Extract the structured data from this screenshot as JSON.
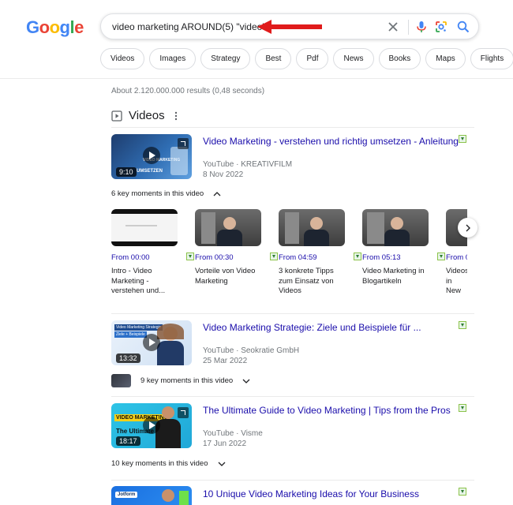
{
  "logo": {
    "letters": [
      "G",
      "o",
      "o",
      "g",
      "l",
      "e"
    ],
    "colors": [
      "#4285f4",
      "#ea4335",
      "#fbbc05",
      "#4285f4",
      "#34a853",
      "#ea4335"
    ]
  },
  "search": {
    "query": "video marketing AROUND(5) \"video\""
  },
  "chips": [
    "Videos",
    "Images",
    "Strategy",
    "Best",
    "Pdf",
    "News",
    "Books",
    "Maps",
    "Flights"
  ],
  "stats": "About 2.120.000.000 results (0,48 seconds)",
  "videos_section": {
    "title": "Videos"
  },
  "video1": {
    "title": "Video Marketing - verstehen und richtig umsetzen - Anleitung",
    "source": "YouTube",
    "channel": "KREATIVFILM",
    "date": "8 Nov 2022",
    "duration": "9:10",
    "moments_label": "6 key moments in this video",
    "key_moments": [
      {
        "from": "From 00:00",
        "label": "Intro - Video Marketing - verstehen und..."
      },
      {
        "from": "From 00:30",
        "label": "Vorteile von Video Marketing"
      },
      {
        "from": "From 04:59",
        "label": "3 konkrete Tipps zum Einsatz von Videos"
      },
      {
        "from": "From 05:13",
        "label": "Video Marketing in Blogartikeln"
      },
      {
        "from": "From 0",
        "label": "Videos in New"
      }
    ]
  },
  "video2": {
    "title": "Video Marketing Strategie: Ziele und Beispiele für ...",
    "source": "YouTube",
    "channel": "Seokratie GmbH",
    "date": "25 Mar 2022",
    "duration": "13:32",
    "moments_label": "9 key moments in this video"
  },
  "video3": {
    "title": "The Ultimate Guide to Video Marketing | Tips from the Pros",
    "source": "YouTube",
    "channel": "Visme",
    "date": "17 Jun 2022",
    "duration": "18:17",
    "moments_label": "10 key moments in this video"
  },
  "video4": {
    "title": "10 Unique Video Marketing Ideas for Your Business"
  },
  "thumb_text": {
    "v1": "VIDEO MARKETING",
    "v1b": "UMSETZEN",
    "v2": "Video Marketing Strategie",
    "v2b": "Ziele + Beispiele",
    "v3": "VIDEO MARKETING",
    "v3b": "The Ultimate",
    "v4": "Jotform"
  },
  "separator": "·"
}
